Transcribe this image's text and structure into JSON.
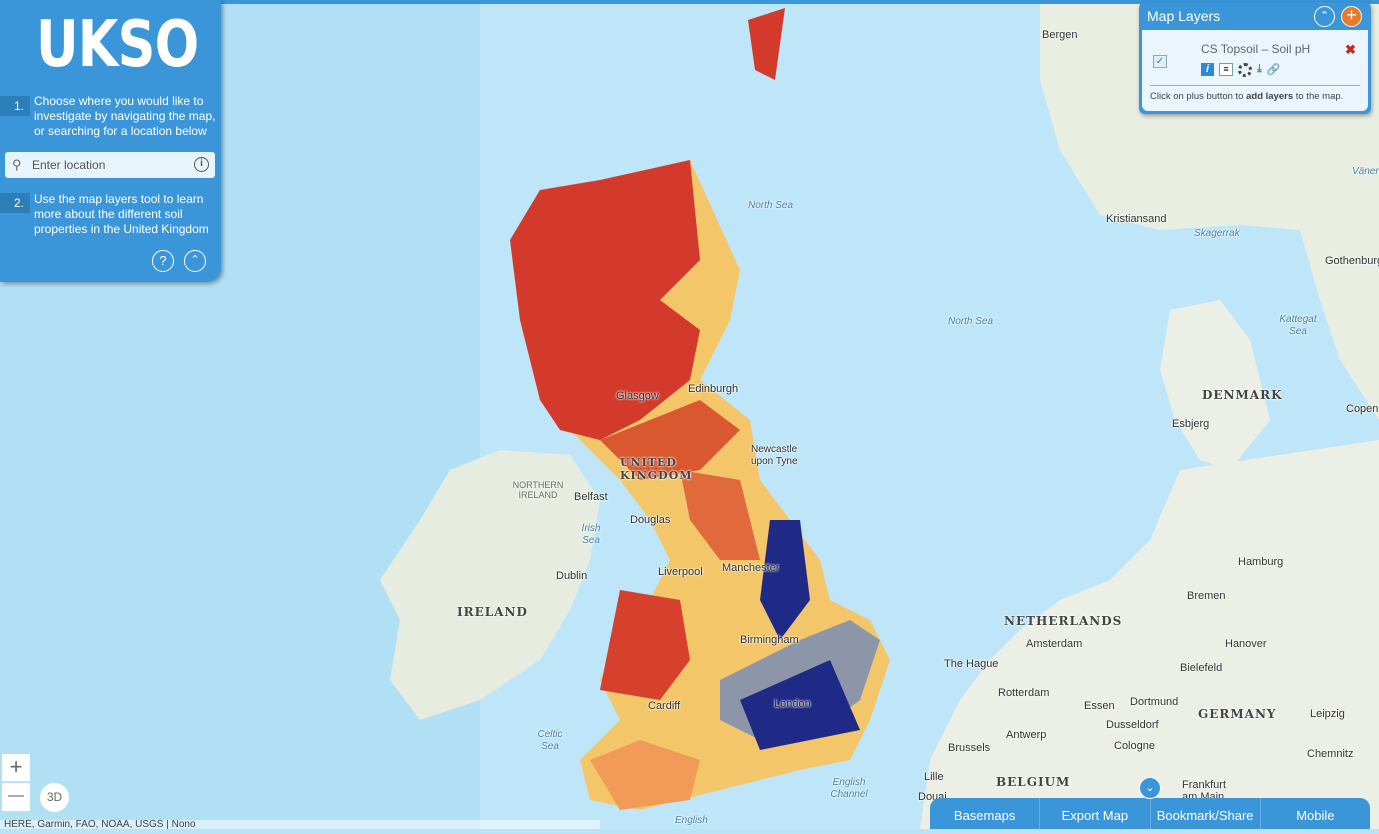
{
  "panel": {
    "logo": "UKSO",
    "step1_num": "1.",
    "step1_text": "Choose where you would like to investigate by navigating the map, or searching for a location below",
    "search_placeholder": "Enter location",
    "step2_num": "2.",
    "step2_text": "Use the map layers tool to learn more about the different soil properties in the United Kingdom",
    "help_icon": "?"
  },
  "layers": {
    "title": "Map Layers",
    "layer_name": "CS Topsoil – Soil pH",
    "layer_checked": true,
    "hint_pre": "Click on plus button to ",
    "hint_bold": "add layers",
    "hint_post": " to the map."
  },
  "map": {
    "zoom_in": "+",
    "zoom_out": "—",
    "btn_3d": "3D",
    "attribution": "HERE, Garmin, FAO, NOAA, USGS | Nono",
    "labels": {
      "north_sea_1": "North Sea",
      "north_sea_2": "North Sea",
      "bergen": "Bergen",
      "kristiansand": "Kristiansand",
      "skagerrak": "Skagerrak",
      "gothenburg": "Gothenburg",
      "vaner": "Väner",
      "kattegat": "Kattegat Sea",
      "denmark": "DENMARK",
      "esbjerg": "Esbjerg",
      "copen": "Copen",
      "edinburgh": "Edinburgh",
      "glasgow": "Glasgow",
      "newcastle": "Newcastle upon Tyne",
      "uk": "UNITED KINGDOM",
      "ni": "NORTHERN IRELAND",
      "belfast": "Belfast",
      "irish_sea": "Irish Sea",
      "douglas": "Douglas",
      "dublin": "Dublin",
      "ireland": "IRELAND",
      "liverpool": "Liverpool",
      "manchester": "Manchester",
      "birmingham": "Birmingham",
      "london": "London",
      "cardiff": "Cardiff",
      "celtic_sea": "Celtic Sea",
      "english_channel": "English Channel",
      "english": "English",
      "netherlands": "NETHERLANDS",
      "amsterdam": "Amsterdam",
      "the_hague": "The Hague",
      "rotterdam": "Rotterdam",
      "hamburg": "Hamburg",
      "bremen": "Bremen",
      "hanover": "Hanover",
      "bielefeld": "Bielefeld",
      "essen": "Essen",
      "dortmund": "Dortmund",
      "dusseldorf": "Dusseldorf",
      "germany": "GERMANY",
      "leipzig": "Leipzig",
      "antwerp": "Antwerp",
      "brussels": "Brussels",
      "cologne": "Cologne",
      "chemnitz": "Chemnitz",
      "lille": "Lille",
      "belgium": "BELGIUM",
      "frankfurt": "Frankfurt am Main",
      "douai": "Douai"
    }
  },
  "bottom": {
    "basemaps": "Basemaps",
    "export": "Export Map",
    "bookmark": "Bookmark/Share",
    "mobile": "Mobile"
  },
  "colors": {
    "accent": "#3a96d8",
    "add": "#e87a2c",
    "soil_acid": "#d73027",
    "soil_mid": "#f4a261",
    "soil_neutral": "#fee08b",
    "soil_alkaline": "#1a237e",
    "soil_gray": "#8c96a8"
  }
}
